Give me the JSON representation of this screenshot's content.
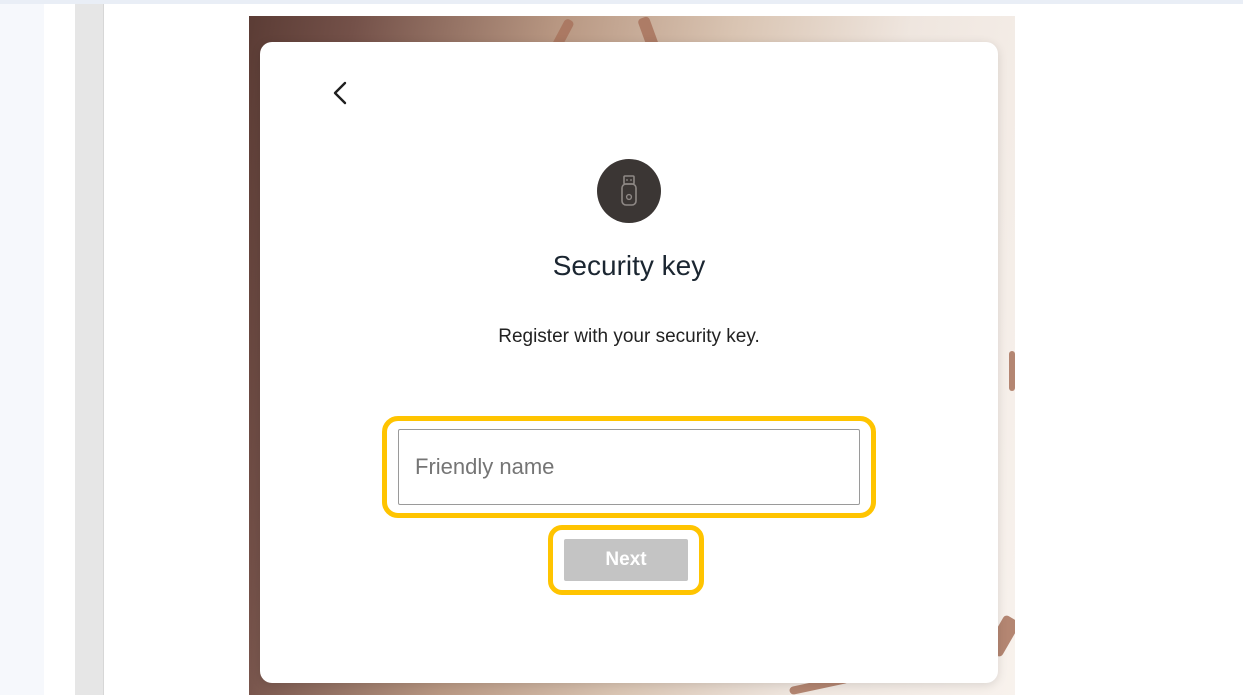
{
  "gutter": {
    "glyph": "]"
  },
  "card": {
    "back_icon": "chevron-left-icon",
    "key_icon": "usb-security-key-icon",
    "title": "Security key",
    "subtitle": "Register with your security key.",
    "friendly_name": {
      "value": "",
      "placeholder": "Friendly name"
    },
    "next_label": "Next"
  },
  "colors": {
    "highlight": "#ffc400",
    "icon_circle": "#3b3634",
    "disabled_button": "#c4c4c4"
  }
}
